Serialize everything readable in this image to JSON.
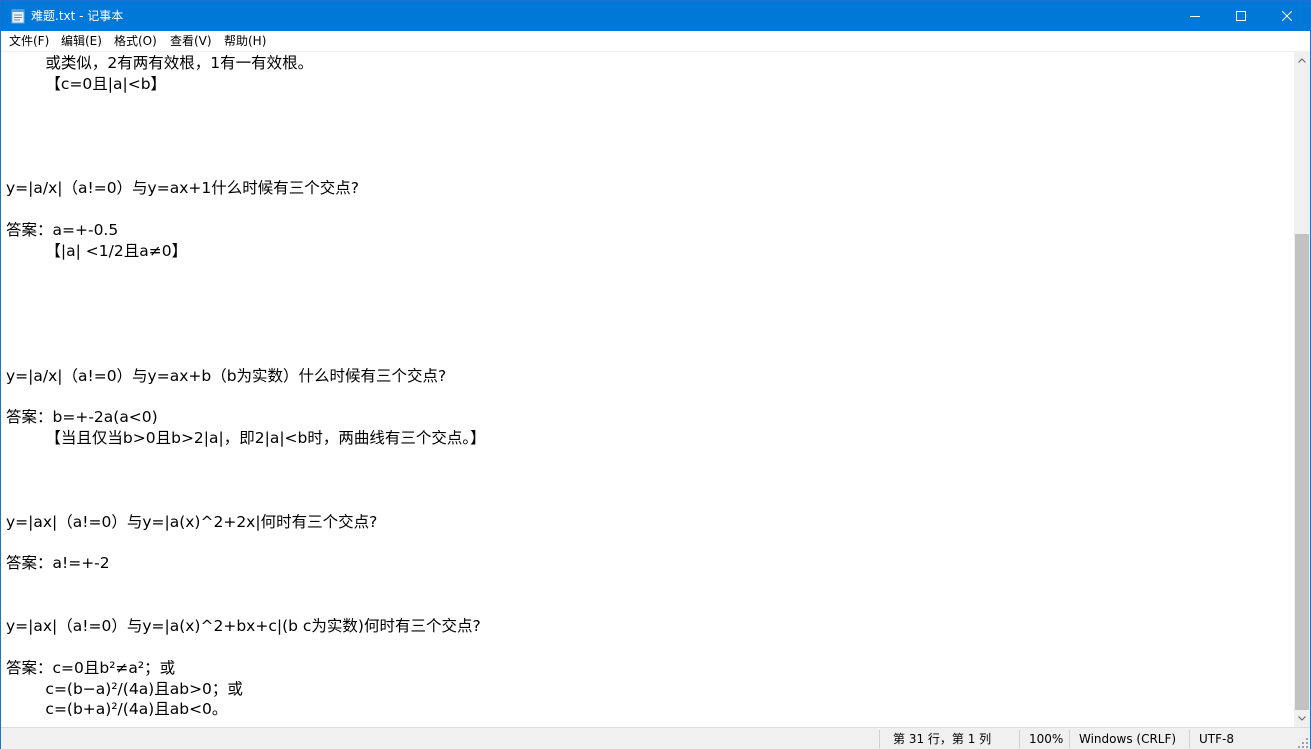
{
  "window": {
    "title": "难题.txt - 记事本",
    "controls": {
      "minimize_icon": "minimize-icon",
      "maximize_icon": "maximize-icon",
      "close_icon": "close-icon"
    }
  },
  "menu": [
    "文件(F)",
    "编辑(E)",
    "格式(O)",
    "查看(V)",
    "帮助(H)"
  ],
  "editor": {
    "lines": [
      "        或类似，2有两有效根，1有一有效根。",
      "        【c=0且|a|<b】",
      "",
      "",
      "",
      "",
      "y=|a/x|（a!=0）与y=ax+1什么时候有三个交点?",
      "",
      "答案：a=+-0.5",
      "        【|a| <1/2且a≠0】",
      "",
      "",
      "",
      "",
      "",
      "y=|a/x|（a!=0）与y=ax+b（b为实数）什么时候有三个交点?",
      "",
      "答案：b=+-2a(a<0)",
      "        【当且仅当b>0且b>2|a|，即2|a|<b时，两曲线有三个交点。】",
      "",
      "",
      "",
      "y=|ax|（a!=0）与y=|a(x)^2+2x|何时有三个交点?",
      "",
      "答案：a!=+-2",
      "",
      "",
      "y=|ax|（a!=0）与y=|a(x)^2+bx+c|(b c为实数)何时有三个交点?",
      "",
      "答案：c=0且b²≠a²；或",
      "        c=(b−a)²/(4a)且ab>0；或",
      "        c=(b+a)²/(4a)且ab<0。"
    ]
  },
  "scrollbar": {
    "position_fraction": 0.27
  },
  "status": {
    "position": "第 31 行，第 1 列",
    "zoom": "100%",
    "line_ending": "Windows (CRLF)",
    "encoding": "UTF-8"
  }
}
